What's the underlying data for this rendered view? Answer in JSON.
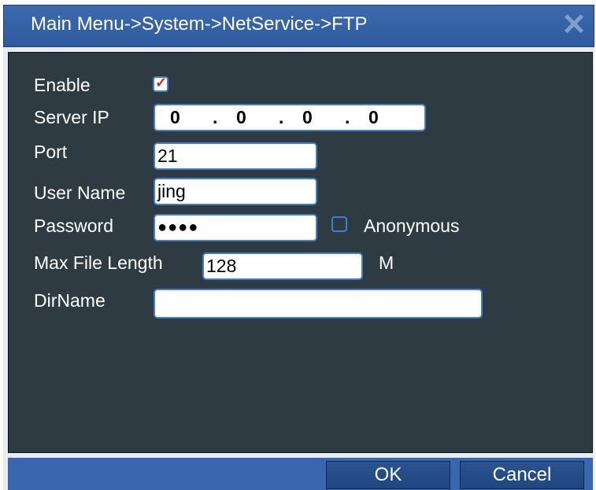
{
  "window": {
    "title": "Main Menu->System->NetService->FTP"
  },
  "form": {
    "enable": {
      "label": "Enable",
      "checked": true
    },
    "server_ip": {
      "label": "Server IP",
      "octets": [
        "0",
        "0",
        "0",
        "0"
      ],
      "separator": "."
    },
    "port": {
      "label": "Port",
      "value": "21"
    },
    "user_name": {
      "label": "User Name",
      "value": "jing"
    },
    "password": {
      "label": "Password",
      "value": "●●●●"
    },
    "anonymous": {
      "label": "Anonymous",
      "checked": false
    },
    "max_file_length": {
      "label": "Max File Length",
      "value": "128",
      "unit": "M"
    },
    "dir_name": {
      "label": "DirName",
      "value": ""
    }
  },
  "buttons": {
    "ok": "OK",
    "cancel": "Cancel"
  },
  "colors": {
    "title_bar": "#3a66b0",
    "panel_bg": "#2f3b42",
    "field_border": "#3f7fd0",
    "check_mark": "#e02020"
  }
}
